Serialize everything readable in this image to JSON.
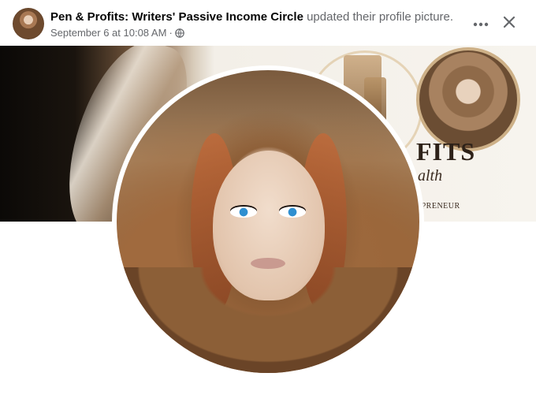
{
  "post": {
    "page_name": "Pen & Profits: Writers' Passive Income Circle",
    "action_text": "updated their profile picture.",
    "timestamp": "September 6 at 10:08 AM",
    "separator": "·",
    "audience_icon": "globe-icon"
  },
  "controls": {
    "more_icon": "more-horizontal-icon",
    "close_icon": "close-icon"
  },
  "cover": {
    "headline_text": "FITS",
    "script_text": "alth",
    "small_text": "EPRENEUR"
  },
  "colors": {
    "text_primary": "#050505",
    "text_secondary": "#65676b",
    "background": "#ffffff"
  }
}
